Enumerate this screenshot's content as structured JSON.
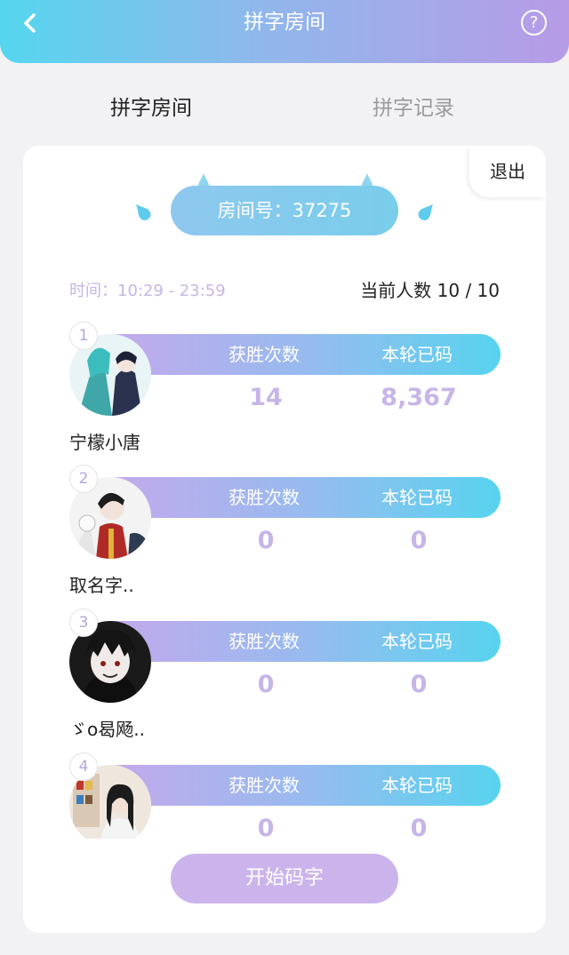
{
  "header": {
    "title": "拼字房间",
    "back_icon": "chevron-left-icon",
    "help_icon": "?"
  },
  "tabs": [
    {
      "label": "拼字房间",
      "active": true
    },
    {
      "label": "拼字记录",
      "active": false
    }
  ],
  "room": {
    "exit_label": "退出",
    "room_number": "房间号：37275",
    "time": "时间：10:29 - 23:59",
    "player_count": "当前人数 10 / 10"
  },
  "stat_labels": {
    "wins": "获胜次数",
    "typed": "本轮已码"
  },
  "players": [
    {
      "rank": "1",
      "name": "宁檬小唐",
      "wins": "14",
      "typed": "8,367"
    },
    {
      "rank": "2",
      "name": "取名字..",
      "wins": "0",
      "typed": "0"
    },
    {
      "rank": "3",
      "name": "ゞo曷飏..",
      "wins": "0",
      "typed": "0"
    },
    {
      "rank": "4",
      "name": "",
      "wins": "0",
      "typed": "0"
    }
  ],
  "start_button": "开始码字",
  "colors": {
    "header_gradient_start": "#55d6ee",
    "header_gradient_end": "#b79be6",
    "accent_purple": "#c7b5e8",
    "start_button": "#cbb4ec"
  }
}
